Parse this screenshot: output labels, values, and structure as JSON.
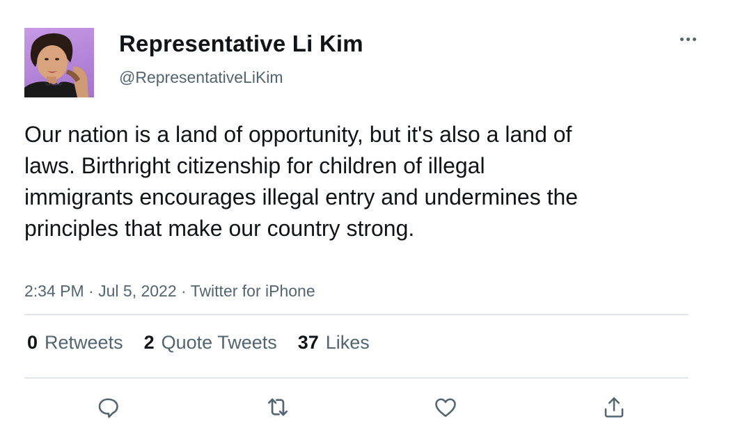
{
  "author": {
    "display_name": "Representative Li Kim",
    "handle": "@RepresentativeLiKim",
    "avatar_icon": "profile-photo"
  },
  "tweet": {
    "text": "Our nation is a land of opportunity, but it's also a land of laws. Birthright citizenship for children of illegal immigrants encourages illegal entry and undermines the principles that make our country strong.",
    "time": "2:34 PM",
    "date": "Jul 5, 2022",
    "source": "Twitter for iPhone",
    "separator": " · "
  },
  "stats": {
    "retweets_count": "0",
    "retweets_label": "Retweets",
    "quotes_count": "2",
    "quotes_label": "Quote Tweets",
    "likes_count": "37",
    "likes_label": "Likes"
  },
  "actions": [
    "reply-icon",
    "retweet-icon",
    "like-icon",
    "share-icon"
  ],
  "colors": {
    "text_primary": "#0f1419",
    "text_secondary": "#536471",
    "divider": "#e1e6ea",
    "icon": "#536471"
  }
}
